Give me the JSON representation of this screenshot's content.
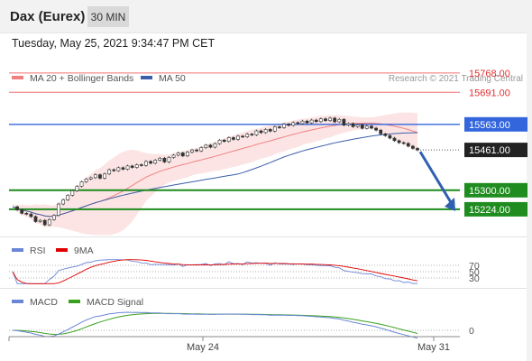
{
  "header": {
    "instrument": "Dax (Eurex)",
    "timeframe": "30 MIN",
    "timestamp": "Tuesday, May 25, 2021 9:34:47 PM CET"
  },
  "chart_data": [
    {
      "type": "candlestick",
      "title": "",
      "legend": [
        {
          "name": "MA 20 + Bollinger Bands",
          "color": "#f08080"
        },
        {
          "name": "MA 50",
          "color": "#3b5fa8"
        }
      ],
      "copyright": "Research © 2021 Trading Central",
      "x_ticks": [
        "May 24",
        "May 31"
      ],
      "ylim": [
        15130,
        15800
      ],
      "levels": [
        {
          "label": "15768.00",
          "value": 15768,
          "kind": "resistance",
          "color": "#f07070"
        },
        {
          "label": "15691.00",
          "value": 15691,
          "kind": "resistance",
          "color": "#f07070"
        },
        {
          "label": "15563.00",
          "value": 15563,
          "kind": "pivot",
          "color": "#3366dd"
        },
        {
          "label": "15461.00",
          "value": 15461,
          "kind": "last_price",
          "color": "#222222"
        },
        {
          "label": "15300.00",
          "value": 15300,
          "kind": "support",
          "color": "#1e8c1e"
        },
        {
          "label": "15224.00",
          "value": 15224,
          "kind": "support",
          "color": "#1e8c1e"
        }
      ],
      "price_series": [
        15234,
        15222,
        15208,
        15205,
        15195,
        15175,
        15180,
        15162,
        15183,
        15200,
        15245,
        15262,
        15280,
        15298,
        15316,
        15334,
        15345,
        15350,
        15362,
        15348,
        15365,
        15382,
        15378,
        15390,
        15384,
        15397,
        15391,
        15402,
        15399,
        15415,
        15408,
        15420,
        15428,
        15413,
        15431,
        15440,
        15449,
        15437,
        15452,
        15461,
        15457,
        15470,
        15480,
        15472,
        15486,
        15500,
        15495,
        15510,
        15503,
        15516,
        15513,
        15524,
        15521,
        15537,
        15530,
        15543,
        15536,
        15553,
        15550,
        15564,
        15559,
        15570,
        15566,
        15576,
        15569,
        15580,
        15574,
        15585,
        15578,
        15588,
        15573,
        15583,
        15560,
        15566,
        15554,
        15561,
        15547,
        15556,
        15548,
        15540,
        15525,
        15518,
        15508,
        15498,
        15490,
        15487,
        15476,
        15467,
        15461
      ],
      "forecast_arrow": {
        "from": 15461,
        "to": 15260
      },
      "grid": false
    },
    {
      "type": "line",
      "name": "RSI panel",
      "legend": [
        {
          "name": "RSI",
          "color": "#6b86d6"
        },
        {
          "name": "9MA",
          "color": "#e00000"
        }
      ],
      "levels": [
        70,
        50,
        30
      ],
      "ylim": [
        10,
        90
      ]
    },
    {
      "type": "line",
      "name": "MACD panel",
      "legend": [
        {
          "name": "MACD",
          "color": "#6b86d6"
        },
        {
          "name": "MACD Signal",
          "color": "#3aa01e"
        }
      ],
      "levels": [
        0
      ]
    }
  ]
}
